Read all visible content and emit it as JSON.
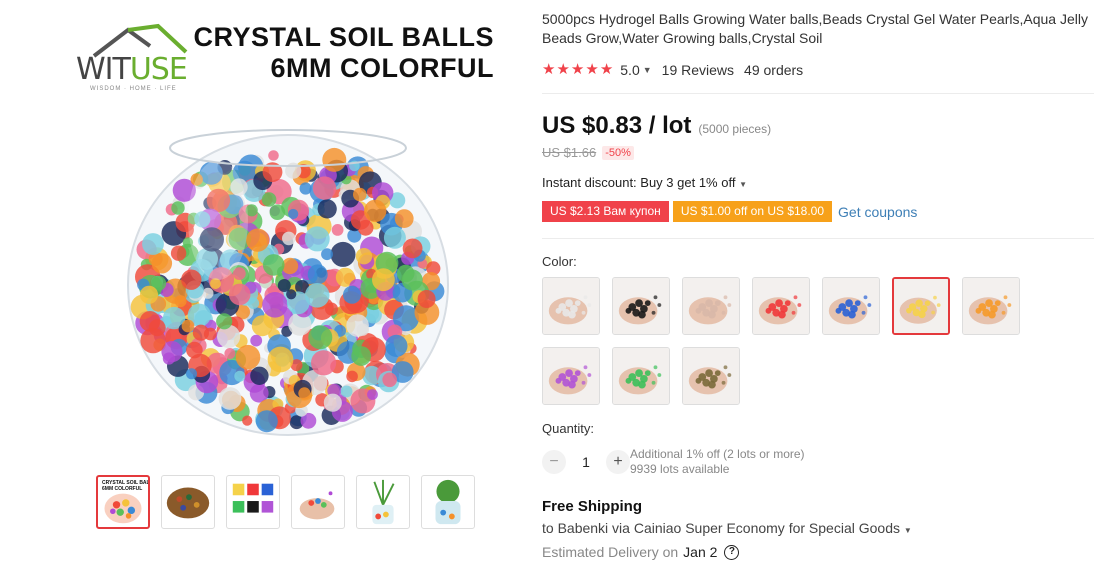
{
  "gallery": {
    "logo": {
      "brand_part1": "WIT",
      "brand_part2": "USE",
      "tagline": "WISDOM · HOME · LIFE"
    },
    "hero_title": {
      "line1": "CRYSTAL SOIL BALLS",
      "line2": "6MM COLORFUL"
    },
    "thumbnails": [
      {
        "name": "thumb-crystal-bowl",
        "active": true
      },
      {
        "name": "thumb-mixed-beads-pile",
        "active": false
      },
      {
        "name": "thumb-color-boxes",
        "active": false
      },
      {
        "name": "thumb-hand-beads",
        "active": false
      },
      {
        "name": "thumb-plant-vase",
        "active": false
      },
      {
        "name": "thumb-succulent-vase",
        "active": false
      }
    ]
  },
  "product": {
    "title": "5000pcs Hydrogel Balls Growing Water balls,Beads Crystal Gel Water Pearls,Aqua Jelly Beads Grow,Water Growing balls,Crystal Soil",
    "rating": {
      "stars": 5,
      "score": "5.0",
      "reviews": "19 Reviews",
      "orders": "49 orders"
    },
    "price": "US $0.83 / lot",
    "pieces": "(5000 pieces)",
    "old_price": "US $1.66",
    "discount": "-50%",
    "instant_discount": "Instant discount: Buy 3 get 1% off",
    "coupons": [
      "US $2.13 Вам купон",
      "US $1.00 off on US $18.00"
    ],
    "get_coupons": "Get coupons",
    "color_label": "Color:",
    "colors": [
      {
        "name": "clear",
        "hex": "#e8e8e8",
        "active": false
      },
      {
        "name": "black",
        "hex": "#1a1a1a",
        "active": false
      },
      {
        "name": "nude",
        "hex": "#d8b8a8",
        "active": false
      },
      {
        "name": "red",
        "hex": "#f0383a",
        "active": false
      },
      {
        "name": "blue",
        "hex": "#2a62d6",
        "active": false
      },
      {
        "name": "yellow",
        "hex": "#f5d24a",
        "active": true
      },
      {
        "name": "orange",
        "hex": "#f59a2a",
        "active": false
      },
      {
        "name": "purple",
        "hex": "#b054d6",
        "active": false
      },
      {
        "name": "green",
        "hex": "#3cc05a",
        "active": false
      },
      {
        "name": "mixed",
        "hex": "#7a6a3a",
        "active": false
      }
    ],
    "quantity_label": "Quantity:",
    "quantity": "1",
    "quantity_minus": "−",
    "quantity_plus": "+",
    "additional_offer": "Additional 1% off (2 lots or more)",
    "available": "9939 lots available",
    "shipping_title": "Free Shipping",
    "shipping_route": "to Babenki via Cainiao Super Economy for Special Goods",
    "delivery_label": "Estimated Delivery on",
    "delivery_date": "Jan 2",
    "help_glyph": "?"
  },
  "colors": {
    "accent_red": "#f0424a",
    "coupon_orange": "#f7a11a",
    "link_blue": "#3e7fb6",
    "brand_green": "#6aae2f"
  }
}
